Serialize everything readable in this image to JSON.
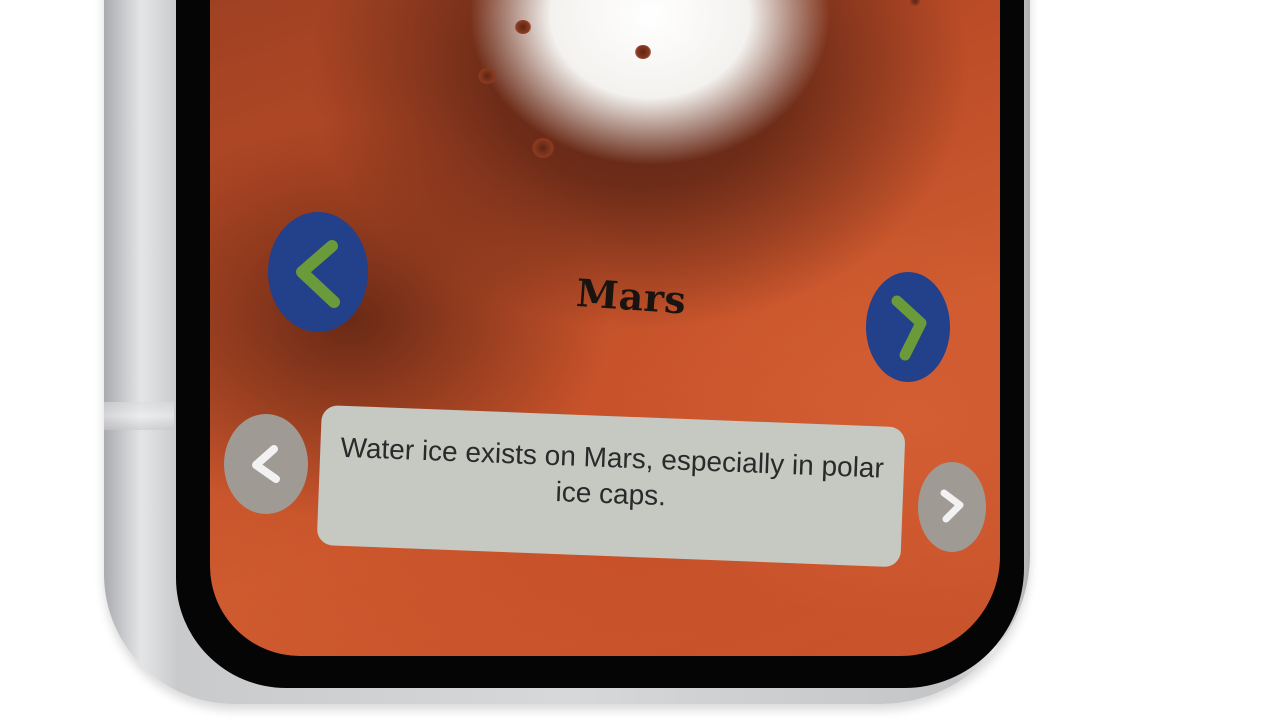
{
  "planet": {
    "name": "Mars"
  },
  "fact": {
    "text": "Water ice exists on Mars, especially in polar ice caps."
  },
  "colors": {
    "planet_nav_bg": "#23408a",
    "planet_nav_arrow": "#6a9a3a",
    "fact_nav_bg": "#a09a95",
    "fact_nav_arrow": "#f2f2f2",
    "fact_card_bg": "#c6c8c2",
    "mars_surface": "#c9542c",
    "polar_cap": "#ffffff",
    "phone_frame": "#d7d8da"
  },
  "icons": {
    "prev_planet": "chevron-left-icon",
    "next_planet": "chevron-right-icon",
    "prev_fact": "chevron-left-icon",
    "next_fact": "chevron-right-icon"
  }
}
